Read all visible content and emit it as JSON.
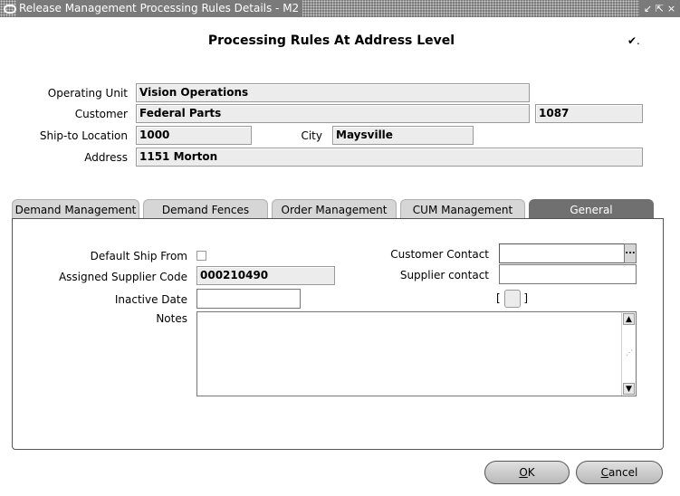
{
  "window": {
    "title": "Release Management Processing Rules Details - M2",
    "controls": [
      "↙",
      "⇱",
      "×"
    ]
  },
  "header": {
    "title": "Processing Rules At Address Level",
    "check_mark": "✔."
  },
  "address": {
    "operating_unit_label": "Operating Unit",
    "operating_unit_value": "Vision Operations",
    "customer_label": "Customer",
    "customer_value": "Federal Parts",
    "customer_number": "1087",
    "ship_to_label": "Ship-to Location",
    "ship_to_value": "1000",
    "city_label": "City",
    "city_value": "Maysville",
    "address_label": "Address",
    "address_value": "1151 Morton"
  },
  "tabs": [
    {
      "label": "Demand Management",
      "active": false
    },
    {
      "label": "Demand Fences",
      "active": false
    },
    {
      "label": "Order Management",
      "active": false
    },
    {
      "label": "CUM Management",
      "active": false
    },
    {
      "label": "General",
      "active": true
    }
  ],
  "general": {
    "default_ship_from_label": "Default Ship From",
    "default_ship_from_checked": false,
    "assigned_supplier_code_label": "Assigned Supplier Code",
    "assigned_supplier_code_value": "000210490",
    "inactive_date_label": "Inactive Date",
    "inactive_date_value": "",
    "notes_label": "Notes",
    "notes_value": "",
    "customer_contact_label": "Customer Contact",
    "customer_contact_value": "",
    "lov_button_label": "...",
    "supplier_contact_label": "Supplier contact",
    "supplier_contact_value": "",
    "flex_open": "[",
    "flex_close": "]"
  },
  "buttons": {
    "ok_mnemonic": "O",
    "ok_rest": "K",
    "cancel_mnemonic": "C",
    "cancel_rest": "ancel"
  }
}
